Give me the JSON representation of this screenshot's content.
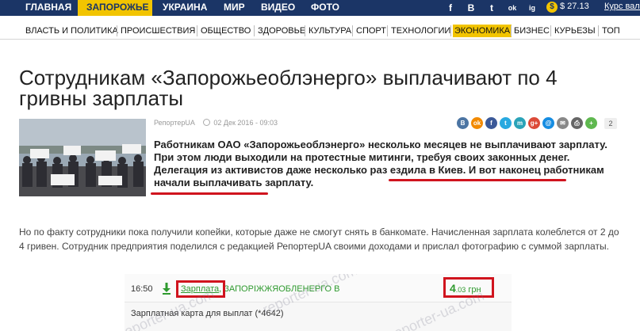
{
  "topnav": {
    "items": [
      "ГЛАВНАЯ",
      "ЗАПОРОЖЬЕ",
      "УКРАИНА",
      "МИР",
      "ВИДЕО",
      "ФОТО"
    ],
    "active": "ЗАПОРОЖЬЕ",
    "social": [
      "f",
      "В",
      "t",
      "ok",
      "ig"
    ],
    "rate_value": "$ 27.13",
    "kurs_link": "Курс валют"
  },
  "subnav": {
    "items": [
      "ВЛАСТЬ И ПОЛИТИКА",
      "ПРОИСШЕСТВИЯ",
      "ОБЩЕСТВО",
      "ЗДОРОВЬЕ",
      "КУЛЬТУРА",
      "СПОРТ",
      "ТЕХНОЛОГИИ",
      "ЭКОНОМИКА",
      "БИЗНЕС",
      "КУРЬЕЗЫ",
      "ТОП"
    ],
    "active": "ЭКОНОМИКА"
  },
  "article": {
    "title": "Сотрудникам «Запорожьеоблэнерго» выплачивают по 4 гривны зарплаты",
    "author": "РепортерUA",
    "date": "02 Дек 2016 - 09:03",
    "share_count": "2",
    "lead_part1": "Работникам ОАО «Запорожьеоблэнерго» несколько месяцев не выплачивают зарплату. При этом люди выходили на протестные митинги, требуя своих законных денег. Делегация из активистов даже несколько раз ездила в Киев. ",
    "lead_part2": "И вот наконец работникам начали выплачивать зарплату.",
    "body": "Но по факту сотрудники пока получили копейки, которые даже не смогут снять в банкомате. Начисленная зарплата колеблется от 2 до 4 гривен. Сотрудник предприятия поделился с редакцией РепортерUA своими доходами и прислал фотографию с суммой зарплаты."
  },
  "inset": {
    "time": "16:50",
    "label_first": "Зарплата",
    "label_rest": ", ЗАПОРІЖЖЯОБЛЕНЕРГО В",
    "amount_major": "4",
    "amount_minor": ".03",
    "currency": "грн",
    "row2": "Зарплатная карта для выплат (*4642)",
    "watermark": "reporter-ua.com"
  },
  "colors": {
    "nav_bg": "#1b3566",
    "accent": "#f2c400",
    "highlight_red": "#d0141e",
    "money_green": "#2e9a2e"
  }
}
